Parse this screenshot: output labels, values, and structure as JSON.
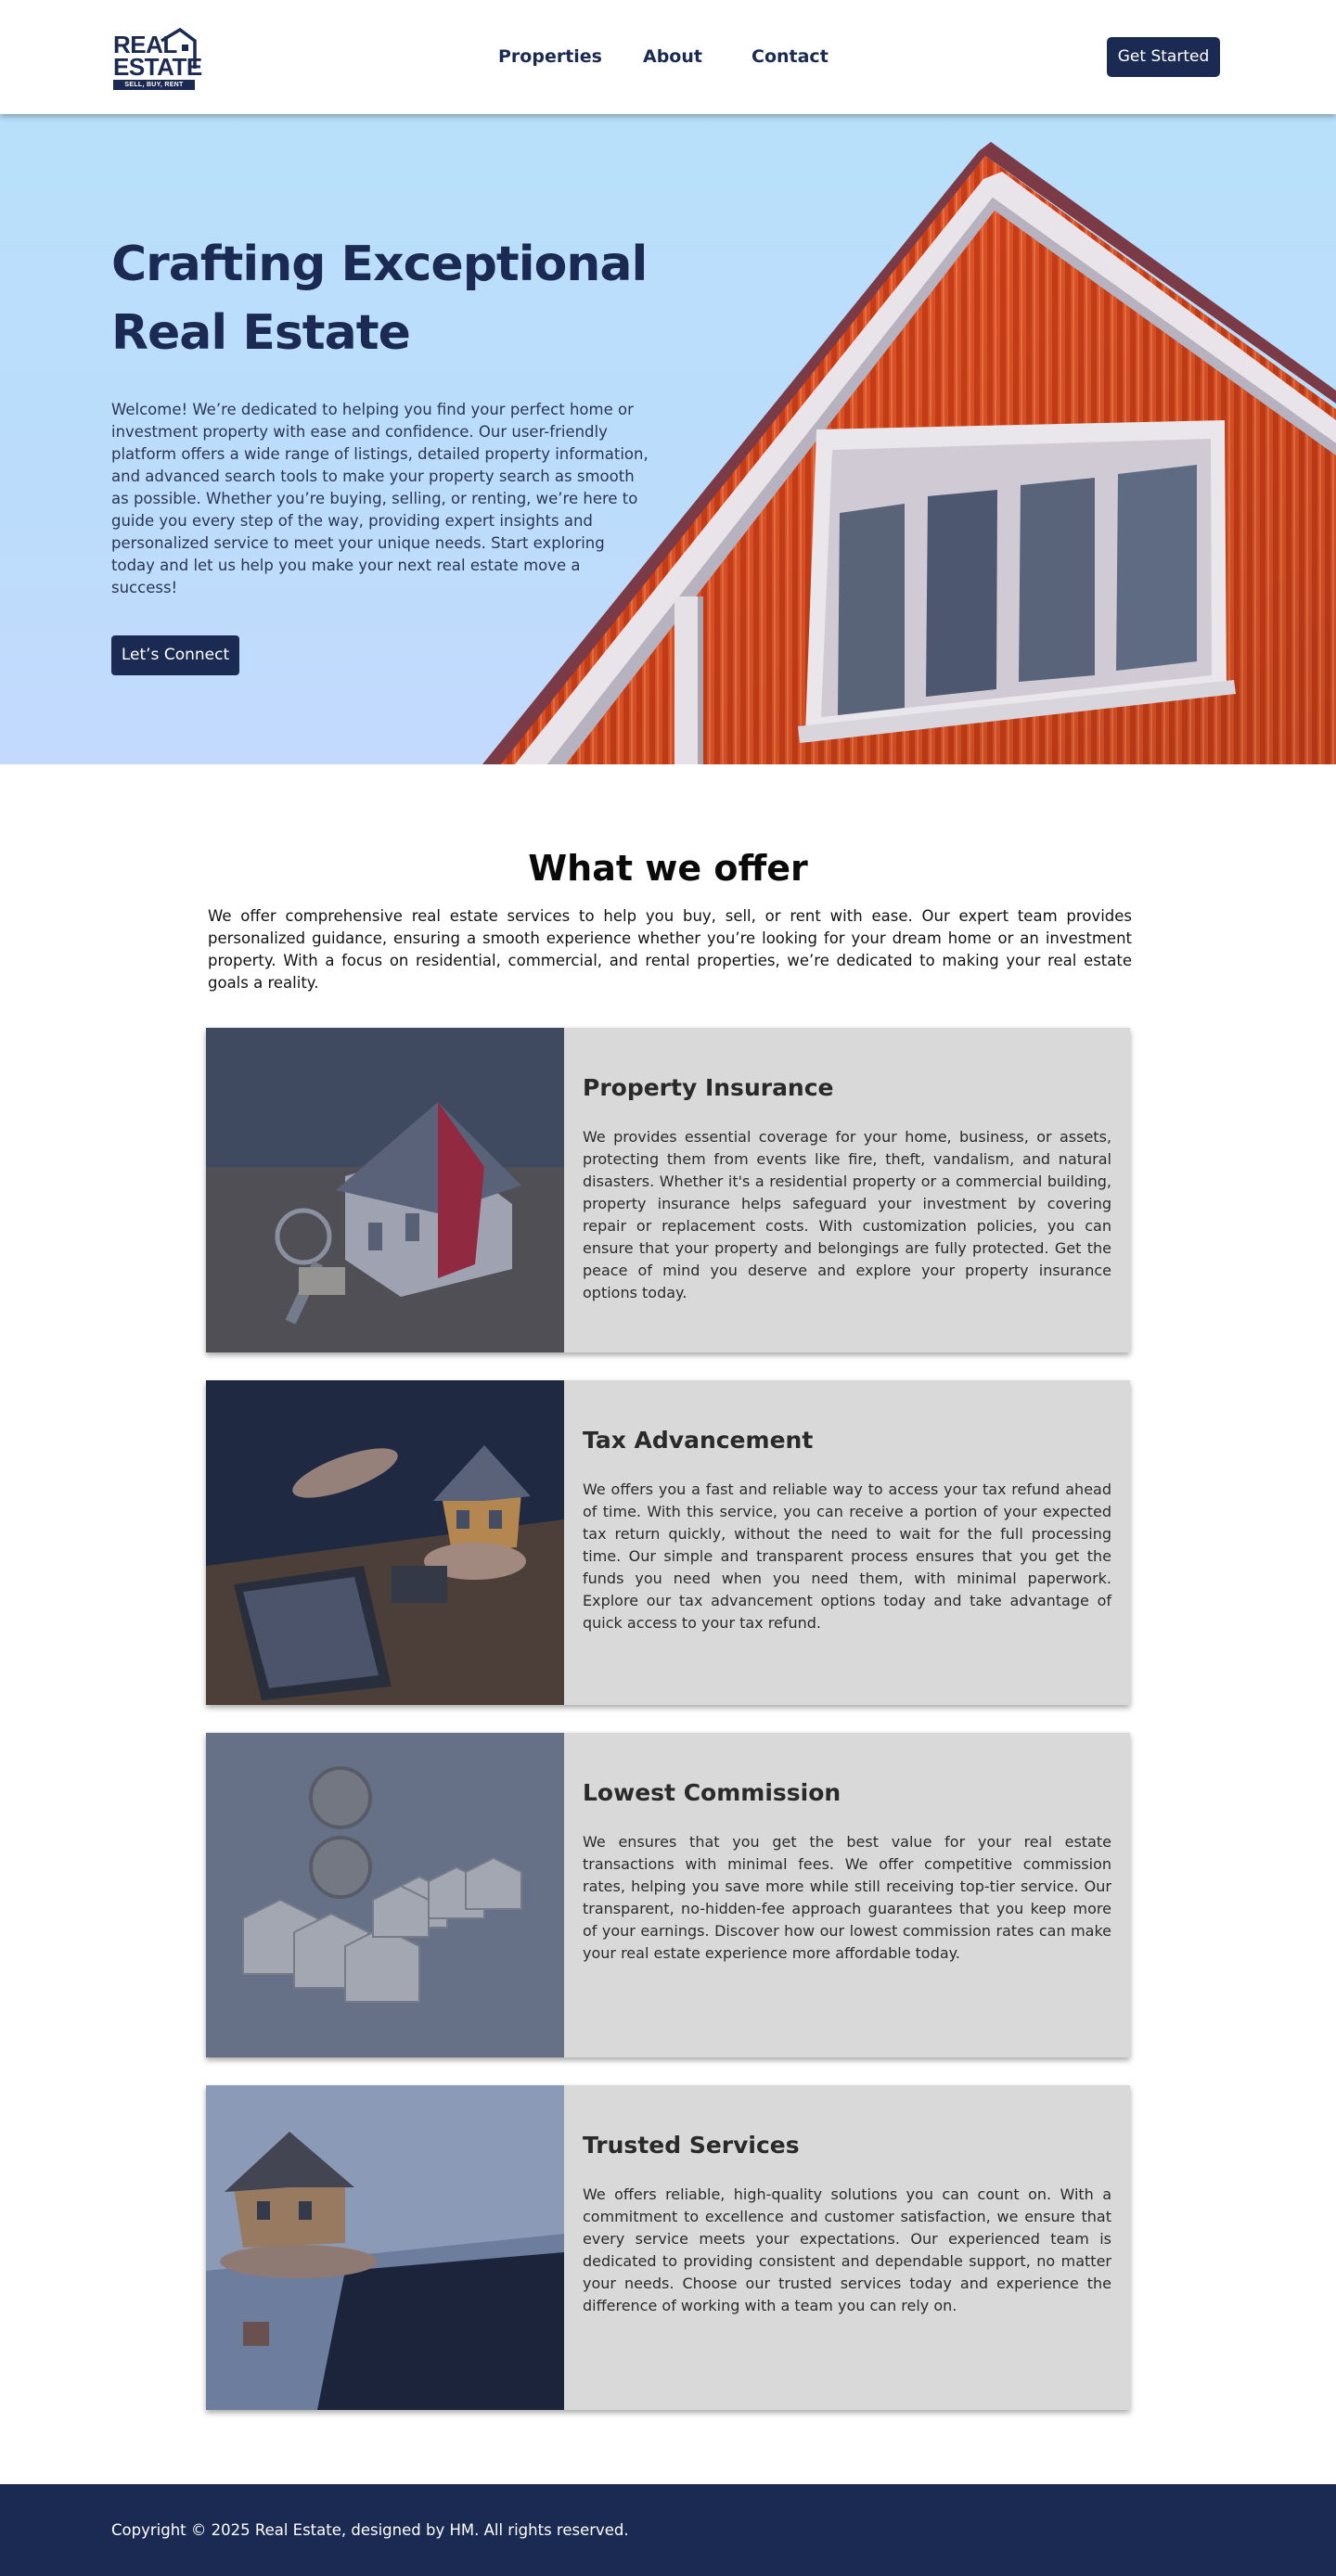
{
  "brand": {
    "logo_line1": "REAL",
    "logo_line2": "ESTATE",
    "logo_tagline": "SELL, BUY, RENT",
    "primary_color": "#1b2a52",
    "accent_color": "#f04f22"
  },
  "nav": {
    "items": [
      "Properties",
      "About",
      "Contact"
    ],
    "cta_label": "Get Started"
  },
  "hero": {
    "title_line1": "Crafting Exceptional",
    "title_line2": "Real Estate",
    "text": "Welcome! We’re dedicated to helping you find your perfect home or investment property with ease and confidence. Our user-friendly platform offers a wide range of listings, detailed property information, and advanced search tools to make your property search as smooth as possible. Whether you’re buying, selling, or renting, we’re here to guide you every step of the way, providing expert insights and personalized service to meet your unique needs. Start exploring today and let us help you make your next real estate move a success!",
    "button_label": "Let’s Connect"
  },
  "offer": {
    "title": "What we offer",
    "intro": "We offer comprehensive real estate services to help you buy, sell, or rent with ease. Our expert team provides personalized guidance, ensuring a smooth experience whether you’re looking for your dream home or an investment property. With a focus on residential, commercial, and rental properties, we’re dedicated to making your real estate goals a reality.",
    "services": [
      {
        "title": "Property Insurance",
        "text": "We provides essential coverage for your home, business, or assets, protecting them from events like fire, theft, vandalism, and natural disasters. Whether it's a residential property or a commercial building, property insurance helps safeguard your investment by covering repair or replacement costs. With customization policies, you can ensure that your property and belongings are fully protected. Get the peace of mind you deserve and explore your property insurance options today."
      },
      {
        "title": "Tax Advancement",
        "text": "We offers you a fast and reliable way to access your tax refund ahead of time. With this service, you can receive a portion of your expected tax return quickly, without the need to wait for the full processing time. Our simple and transparent process ensures that you get the funds you need when you need them, with minimal paperwork. Explore our tax advancement options today and take advantage of quick access to your tax refund."
      },
      {
        "title": "Lowest Commission",
        "text": "We ensures that you get the best value for your real estate transactions with minimal fees. We offer competitive commission rates, helping you save more while still receiving top-tier service. Our transparent, no-hidden-fee approach guarantees that you keep more of your earnings. Discover how our lowest commission rates can make your real estate experience more affordable today."
      },
      {
        "title": "Trusted Services",
        "text": "We offers reliable, high-quality solutions you can count on. With a commitment to excellence and customer satisfaction, we ensure that every service meets your expectations. Our experienced team is dedicated to providing consistent and dependable support, no matter your needs. Choose our trusted services today and experience the difference of working with a team you can rely on."
      }
    ]
  },
  "footer": {
    "copyright": "Copyright © 2025 Real Estate, designed by HM. All rights reserved."
  }
}
